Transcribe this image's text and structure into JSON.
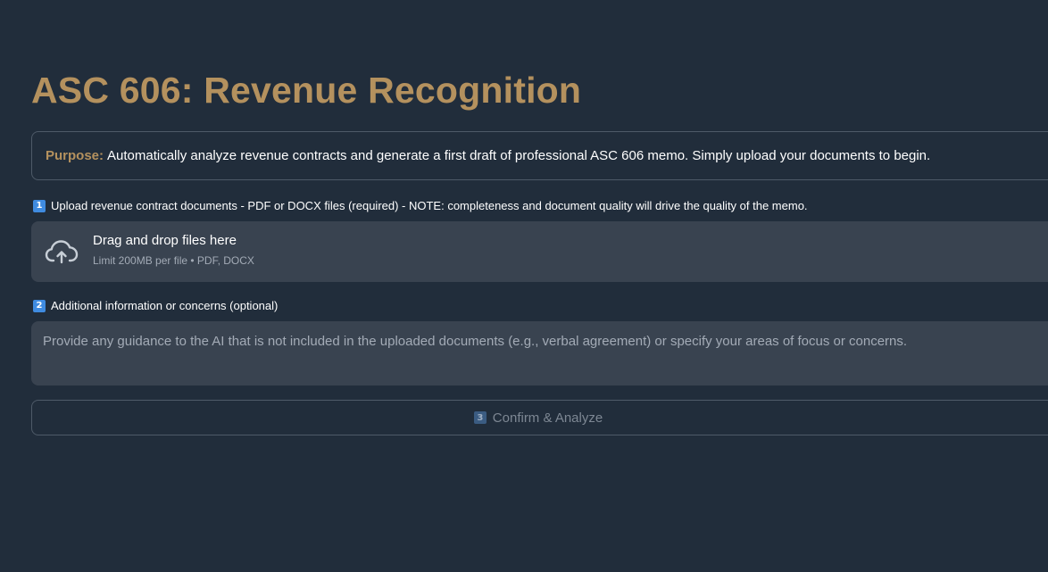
{
  "page": {
    "title": "ASC 606: Revenue Recognition"
  },
  "purpose": {
    "label": "Purpose:",
    "text": "Automatically analyze revenue contracts and generate a first draft of professional ASC 606 memo. Simply upload your documents to begin."
  },
  "step1": {
    "badge": "1",
    "label": "Upload revenue contract documents - PDF or DOCX files (required) - NOTE: completeness and document quality will drive the quality of the memo."
  },
  "uploader": {
    "icon": "cloud-upload-icon",
    "main_text": "Drag and drop files here",
    "sub_text": "Limit 200MB per file • PDF, DOCX"
  },
  "step2": {
    "badge": "2",
    "label": "Additional information or concerns (optional)"
  },
  "notes": {
    "value": "",
    "placeholder": "Provide any guidance to the AI that is not included in the uploaded documents (e.g., verbal agreement) or specify your areas of focus or concerns."
  },
  "confirm": {
    "badge": "3",
    "label": "Confirm & Analyze",
    "disabled": true
  },
  "colors": {
    "background": "#212d3b",
    "accent_gold": "#b4915e",
    "input_bg": "#394350",
    "badge_blue": "#3f8be0"
  }
}
